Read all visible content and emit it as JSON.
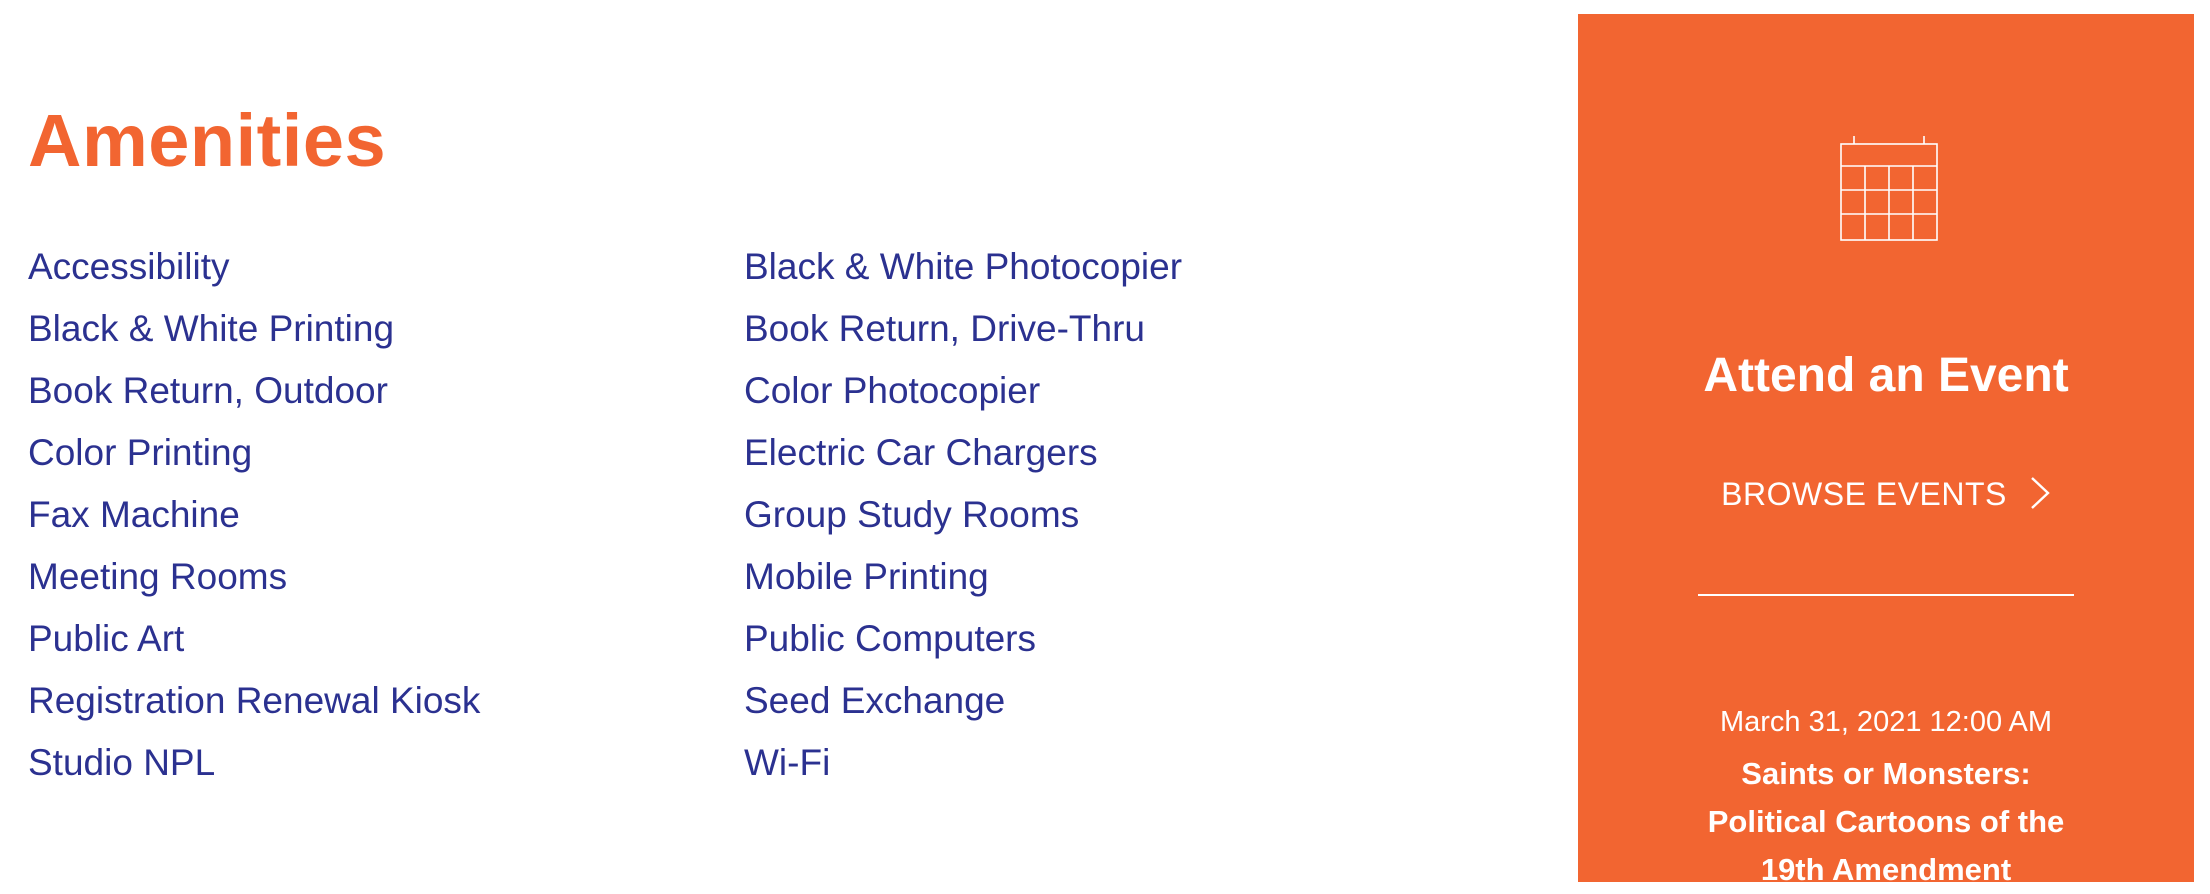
{
  "amenities": {
    "title": "Amenities",
    "column_1": [
      "Accessibility",
      "Black & White Printing",
      "Book Return, Outdoor",
      "Color Printing",
      "Fax Machine",
      "Meeting Rooms",
      "Public Art",
      "Registration Renewal Kiosk",
      "Studio NPL"
    ],
    "column_2": [
      "Black & White Photocopier",
      "Book Return, Drive-Thru",
      "Color Photocopier",
      "Electric Car Chargers",
      "Group Study Rooms",
      "Mobile Printing",
      "Public Computers",
      "Seed Exchange",
      "Wi-Fi"
    ]
  },
  "event_panel": {
    "icon": "calendar-icon",
    "heading": "Attend an Event",
    "browse_label": "BROWSE EVENTS",
    "browse_icon": "chevron-right-icon",
    "event": {
      "date": "March 31, 2021 12:00 AM",
      "title": "Saints or Monsters: Political Cartoons of the 19th Amendment"
    }
  },
  "colors": {
    "accent": "#f26531",
    "link": "#2b3190",
    "panel_text": "#ffffff"
  }
}
